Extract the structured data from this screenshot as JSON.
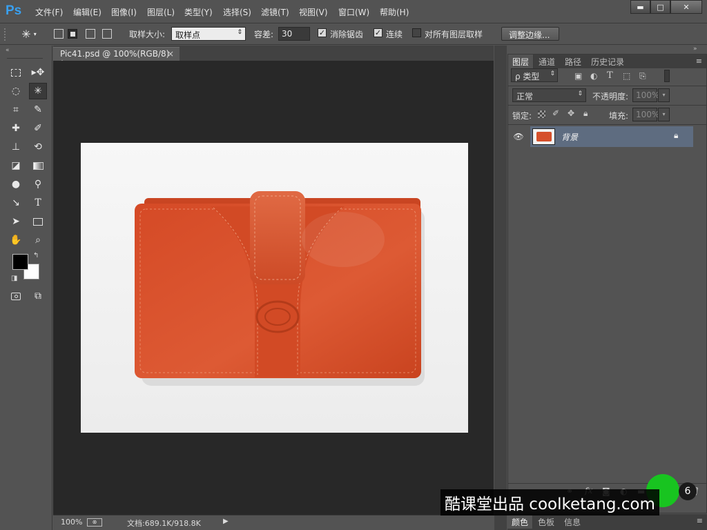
{
  "app": {
    "logo": "Ps"
  },
  "menu": [
    "文件(F)",
    "编辑(E)",
    "图像(I)",
    "图层(L)",
    "类型(Y)",
    "选择(S)",
    "滤镜(T)",
    "视图(V)",
    "窗口(W)",
    "帮助(H)"
  ],
  "window_controls": {
    "minimize": "▬",
    "maximize": "□",
    "close": "✕"
  },
  "options": {
    "tool_icon": "magic-wand-icon",
    "sample_size_label": "取样大小:",
    "sample_size_value": "取样点",
    "tolerance_label": "容差:",
    "tolerance_value": "30",
    "antialias_label": "消除锯齿",
    "antialias_checked": true,
    "contiguous_label": "连续",
    "contiguous_checked": true,
    "sample_all_label": "对所有图层取样",
    "sample_all_checked": false,
    "refine_edge_label": "调整边缘..."
  },
  "document": {
    "tab_title": "Pic41.psd @ 100%(RGB/8) *",
    "tab_close": "×",
    "zoom": "100%",
    "doc_info": "文档:689.1K/918.8K"
  },
  "layers_panel": {
    "tabs": [
      "图层",
      "通道",
      "路径",
      "历史记录"
    ],
    "filter_kind": "ρ 类型",
    "blend_mode": "正常",
    "opacity_label": "不透明度:",
    "opacity_value": "100%",
    "lock_label": "锁定:",
    "fill_label": "填充:",
    "fill_value": "100%",
    "layer_name": "背景"
  },
  "bottom_tabs": [
    "颜色",
    "色板",
    "信息"
  ],
  "watermark": {
    "text": "酷课堂出品 coolketang.com",
    "step": "6"
  },
  "colors": {
    "accent": "#39a0f0",
    "wallet": "#d9532f",
    "layer_selected": "#5e6c80",
    "highlight": "#18c420"
  }
}
